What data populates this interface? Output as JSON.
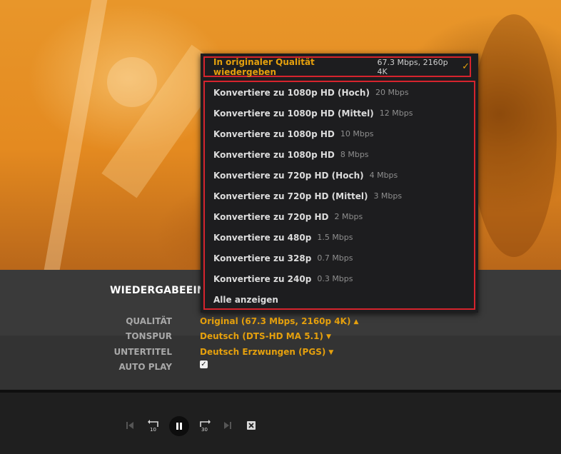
{
  "settings": {
    "heading": "WIEDERGABEEINS",
    "quality_label": "QUALITÄT",
    "quality_value": "Original (67.3 Mbps, 2160p 4K)",
    "audio_label": "TONSPUR",
    "audio_value": "Deutsch (DTS-HD MA 5.1)",
    "subtitle_label": "UNTERTITEL",
    "subtitle_value": "Deutsch Erzwungen (PGS)",
    "autoplay_label": "AUTO PLAY",
    "autoplay_checked": true
  },
  "quality_menu": {
    "original": {
      "label": "In originaler Qualität wiedergeben",
      "info": "67.3 Mbps, 2160p 4K",
      "selected": true
    },
    "options": [
      {
        "label": "Konvertiere zu 1080p HD (Hoch)",
        "bitrate": "20 Mbps"
      },
      {
        "label": "Konvertiere zu 1080p HD (Mittel)",
        "bitrate": "12 Mbps"
      },
      {
        "label": "Konvertiere zu 1080p HD",
        "bitrate": "10 Mbps"
      },
      {
        "label": "Konvertiere zu 1080p HD",
        "bitrate": "8 Mbps"
      },
      {
        "label": "Konvertiere zu 720p HD (Hoch)",
        "bitrate": "4 Mbps"
      },
      {
        "label": "Konvertiere zu 720p HD (Mittel)",
        "bitrate": "3 Mbps"
      },
      {
        "label": "Konvertiere zu 720p HD",
        "bitrate": "2 Mbps"
      },
      {
        "label": "Konvertiere zu 480p",
        "bitrate": "1.5 Mbps"
      },
      {
        "label": "Konvertiere zu 328p",
        "bitrate": "0.7 Mbps"
      },
      {
        "label": "Konvertiere zu 240p",
        "bitrate": "0.3 Mbps"
      }
    ],
    "show_all": "Alle anzeigen"
  },
  "controls": {
    "skip_back_seconds": "10",
    "skip_forward_seconds": "30",
    "icons": [
      "previous-track-icon",
      "skip-back-icon",
      "pause-icon",
      "skip-forward-icon",
      "next-track-icon",
      "stop-icon"
    ]
  },
  "colors": {
    "accent": "#e5a00d",
    "highlight_border": "#d6242d",
    "menu_bg": "#1d1d1f"
  }
}
